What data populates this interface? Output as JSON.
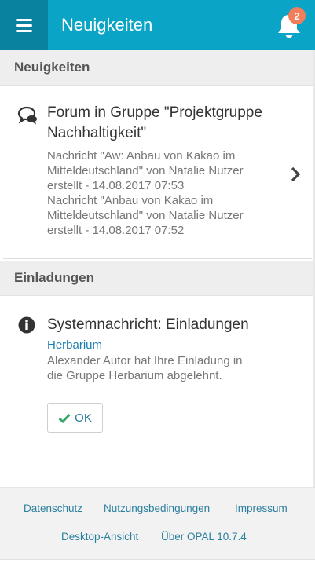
{
  "header": {
    "title": "Neuigkeiten",
    "notification_count": "2",
    "bar_color": "#0aa4c7",
    "menu_color": "#08829f"
  },
  "sections": {
    "news": {
      "heading": "Neuigkeiten",
      "item": {
        "icon": "forum-chat-icon",
        "title_line1": "Forum in Gruppe \"Projektgruppe",
        "title_line2": "Nachhaltigkeit\"",
        "lines": [
          "Nachricht \"Aw: Anbau von Kakao im",
          "Mitteldeutschland\" von Natalie Nutzer",
          "erstellt - 14.08.2017 07:53",
          "Nachricht \"Anbau von Kakao im",
          "Mitteldeutschland\" von Natalie Nutzer",
          "erstellt - 14.08.2017 07:52"
        ]
      }
    },
    "invitations": {
      "heading": "Einladungen",
      "item": {
        "icon": "info-icon",
        "title": "Systemnachricht: Einladungen",
        "link": "Herbarium",
        "lines": [
          "Alexander Autor hat Ihre Einladung in",
          "die Gruppe Herbarium abgelehnt."
        ],
        "ok_label": "OK"
      }
    }
  },
  "footer": {
    "links": [
      "Datenschutz",
      "Nutzungsbedingungen",
      "Impressum",
      "Desktop-Ansicht",
      "Über OPAL 10.7.4"
    ]
  }
}
